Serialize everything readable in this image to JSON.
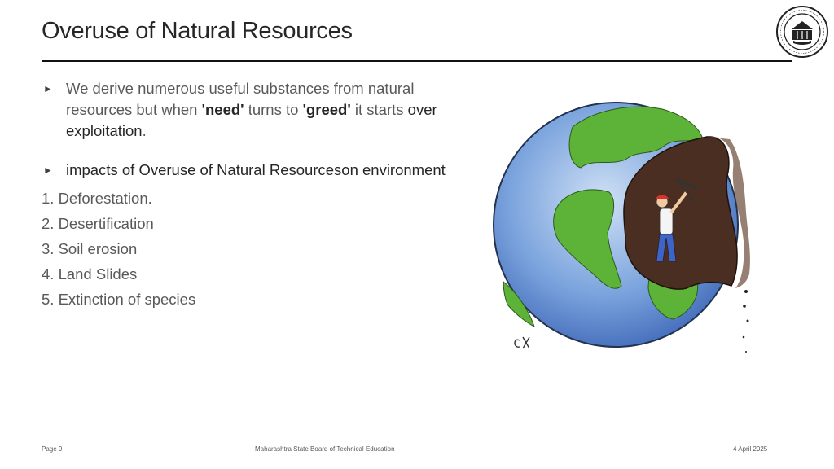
{
  "slide": {
    "title": "Overuse of Natural Resources",
    "bullet1": {
      "part1": "We derive numerous useful substances from natural resources but when ",
      "need": "'need'",
      "part2": " turns to ",
      "greed": "'greed'",
      "part3": " it starts ",
      "over": "over exploitation",
      "part4": "."
    },
    "bullet2": "impacts of Overuse of Natural Resourceson environment",
    "list": [
      "1. Deforestation.",
      "2. Desertification",
      "3. Soil erosion",
      "4. Land Slides",
      "5. Extinction of species"
    ]
  },
  "footer": {
    "page": "Page 9",
    "org": "Maharashtra State Board of Technical Education",
    "date": "4 April 2025"
  },
  "icons": {
    "logo": "msbte-emblem",
    "bullet": "triangle-right-icon"
  },
  "colors": {
    "ocean": "#4a7fd0",
    "land": "#5db338",
    "soil": "#4a2e22",
    "title": "#262626"
  }
}
